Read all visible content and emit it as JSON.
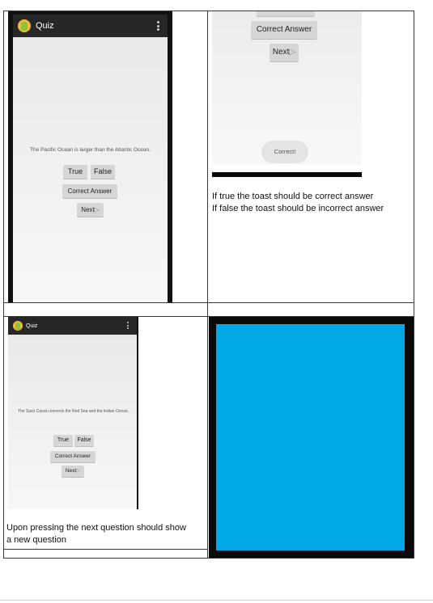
{
  "app": {
    "title": "Quiz"
  },
  "screen1": {
    "question": "The Pacific Ocean is larger than the Atlantic Ocean.",
    "true_label": "True",
    "false_label": "False",
    "correct_answer_label": "Correct Answer",
    "next_label": "Next",
    "next_icon": "▷"
  },
  "screen2": {
    "correct_answer_label": "Correct Answer",
    "next_label": "Next",
    "next_icon": "▷",
    "toast": "Correct!"
  },
  "caption_top_right": {
    "line1": "If true the toast should be correct answer",
    "line2": "If false the toast should be incorrect answer"
  },
  "screen3": {
    "question": "The Suez Canal connects the Red Sea and the Indian Ocean.",
    "true_label": "True",
    "false_label": "False",
    "correct_answer_label": "Correct Answer",
    "next_label": "Next",
    "next_icon": "▷"
  },
  "caption_bottom_left": {
    "line1": "Upon pressing the next question should show",
    "line2": "a new question"
  },
  "colors": {
    "blue_panel": "#00a8e8",
    "action_bar": "#262626"
  }
}
